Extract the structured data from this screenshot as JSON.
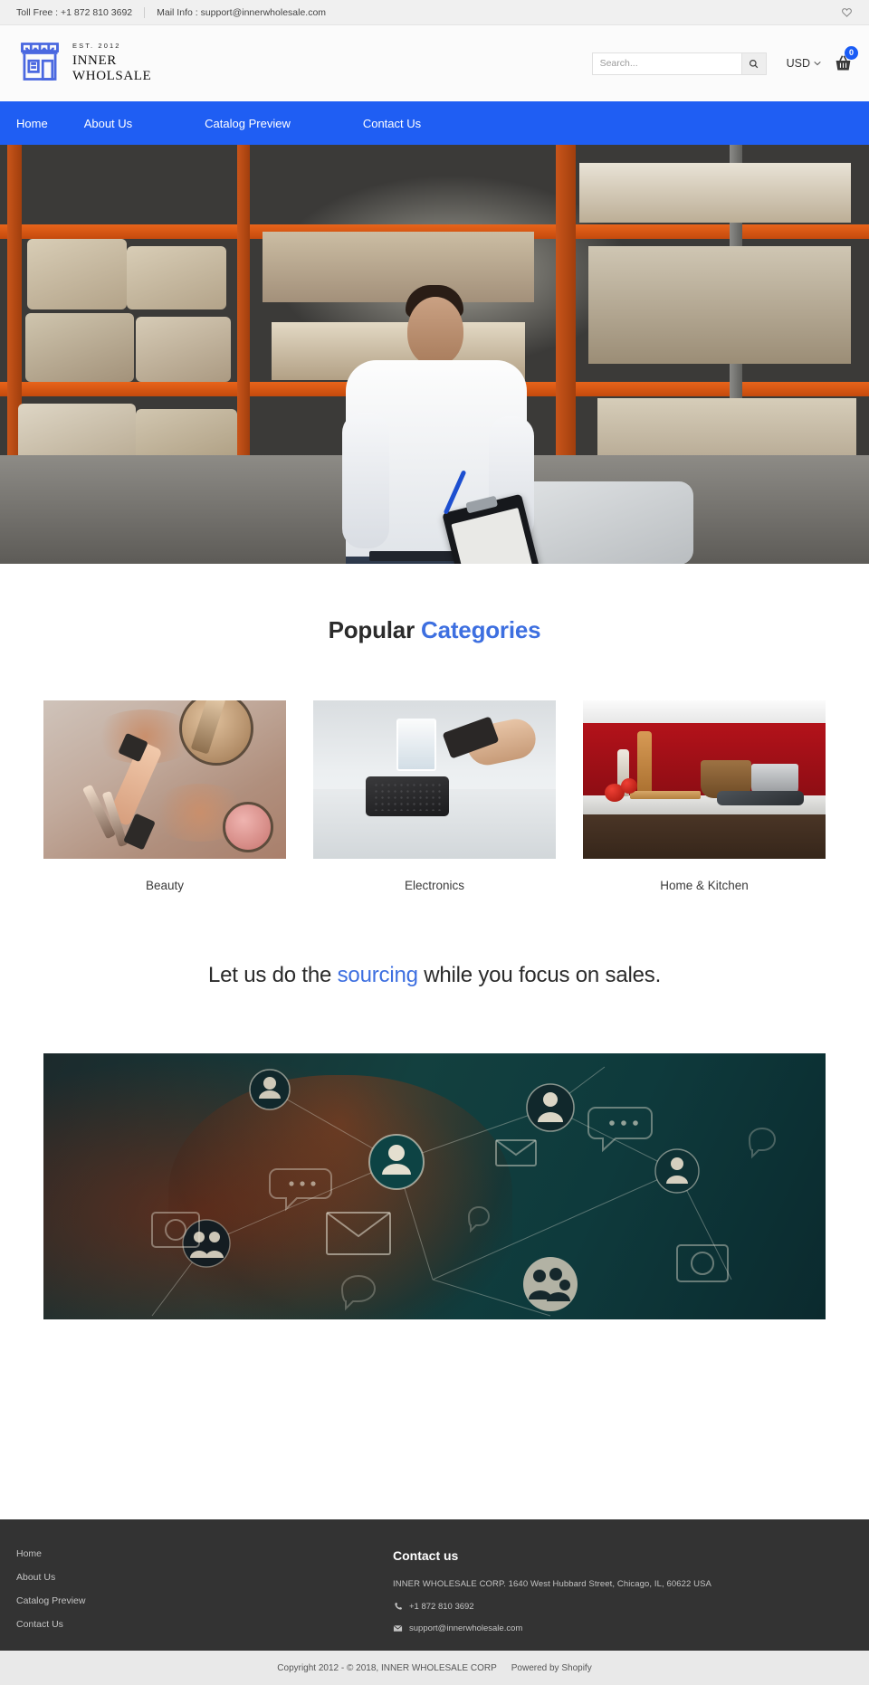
{
  "topbar": {
    "toll_free": "Toll Free : +1 872 810 3692",
    "mail_info": "Mail Info : support@innerwholesale.com",
    "wishlist_icon": "heart-icon"
  },
  "header": {
    "logo": {
      "icon": "storefront-icon",
      "est": "EST. 2012",
      "line1": "INNER",
      "line2": "WHOLSALE"
    },
    "search": {
      "placeholder": "Search...",
      "value": "",
      "icon": "search-icon"
    },
    "currency": {
      "value": "USD",
      "icon": "chevron-down-icon"
    },
    "cart": {
      "icon": "shopping-basket-icon",
      "count": "0",
      "badge_color": "#1a5cf5"
    }
  },
  "nav": {
    "background": "#1f5ef3",
    "items": [
      {
        "label": "Home"
      },
      {
        "label": "About Us"
      },
      {
        "label": "Catalog Preview"
      },
      {
        "label": "Contact Us"
      }
    ]
  },
  "hero": {
    "alt": "Warehouse worker with clipboard in front of pallet racking"
  },
  "categories": {
    "heading_plain": "Popular ",
    "heading_accent": "Categories",
    "accent_color": "#3d6fe0",
    "items": [
      {
        "label": "Beauty",
        "image": "makeup-products-photo"
      },
      {
        "label": "Electronics",
        "image": "bluetooth-speaker-photo"
      },
      {
        "label": "Home & Kitchen",
        "image": "red-kitchen-photo"
      }
    ]
  },
  "tagline": {
    "part1": "Let us do the ",
    "accent": "sourcing",
    "part2": " while you focus on sales."
  },
  "banner": {
    "alt": "Business networking graphic with connected user icons"
  },
  "footer": {
    "links": [
      {
        "label": "Home"
      },
      {
        "label": "About Us"
      },
      {
        "label": "Catalog Preview"
      },
      {
        "label": "Contact Us"
      }
    ],
    "contact": {
      "title": "Contact us",
      "address": "INNER WHOLESALE CORP. 1640 West Hubbard Street, Chicago, IL, 60622     USA",
      "phone": "+1 872 810 3692",
      "phone_icon": "phone-icon",
      "email": "support@innerwholesale.com",
      "email_icon": "envelope-icon"
    }
  },
  "copyright": {
    "text": "Copyright 2012 - © 2018, INNER WHOLESALE CORP",
    "powered": "Powered by Shopify"
  }
}
